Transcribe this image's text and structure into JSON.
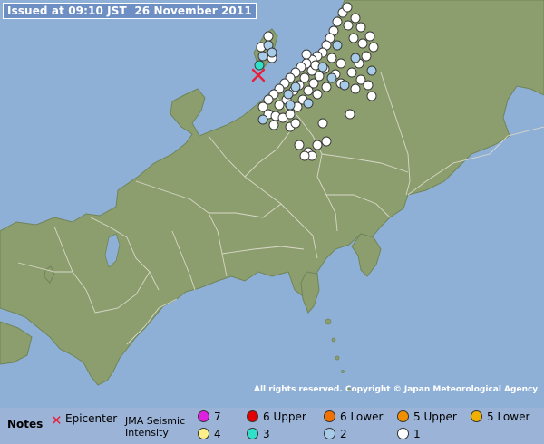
{
  "issued": "Issued at 09:10 JST  26 November 2011",
  "copyright": "All rights reserved. Copyright © Japan Meteorological Agency",
  "legend": {
    "notes": "Notes",
    "epicenter": "Epicenter",
    "scale_line1": "JMA Seismic",
    "scale_line2": "Intensity",
    "levels": [
      {
        "label": "7",
        "color": "#e020e0"
      },
      {
        "label": "6 Upper",
        "color": "#e00000"
      },
      {
        "label": "6 Lower",
        "color": "#f07000"
      },
      {
        "label": "5 Upper",
        "color": "#f09000"
      },
      {
        "label": "5 Lower",
        "color": "#f0b000"
      },
      {
        "label": "4",
        "color": "#ffef88"
      },
      {
        "label": "3",
        "color": "#30e0c8"
      },
      {
        "label": "2",
        "color": "#a8cce8"
      },
      {
        "label": "1",
        "color": "#ffffff"
      }
    ]
  },
  "colors": {
    "sea": "#8fb0d6",
    "land": "#8c9e6e",
    "border": "#d8d8c8",
    "epicenter_mark": "#e8203a"
  },
  "epicenter_symbol": "✕"
}
